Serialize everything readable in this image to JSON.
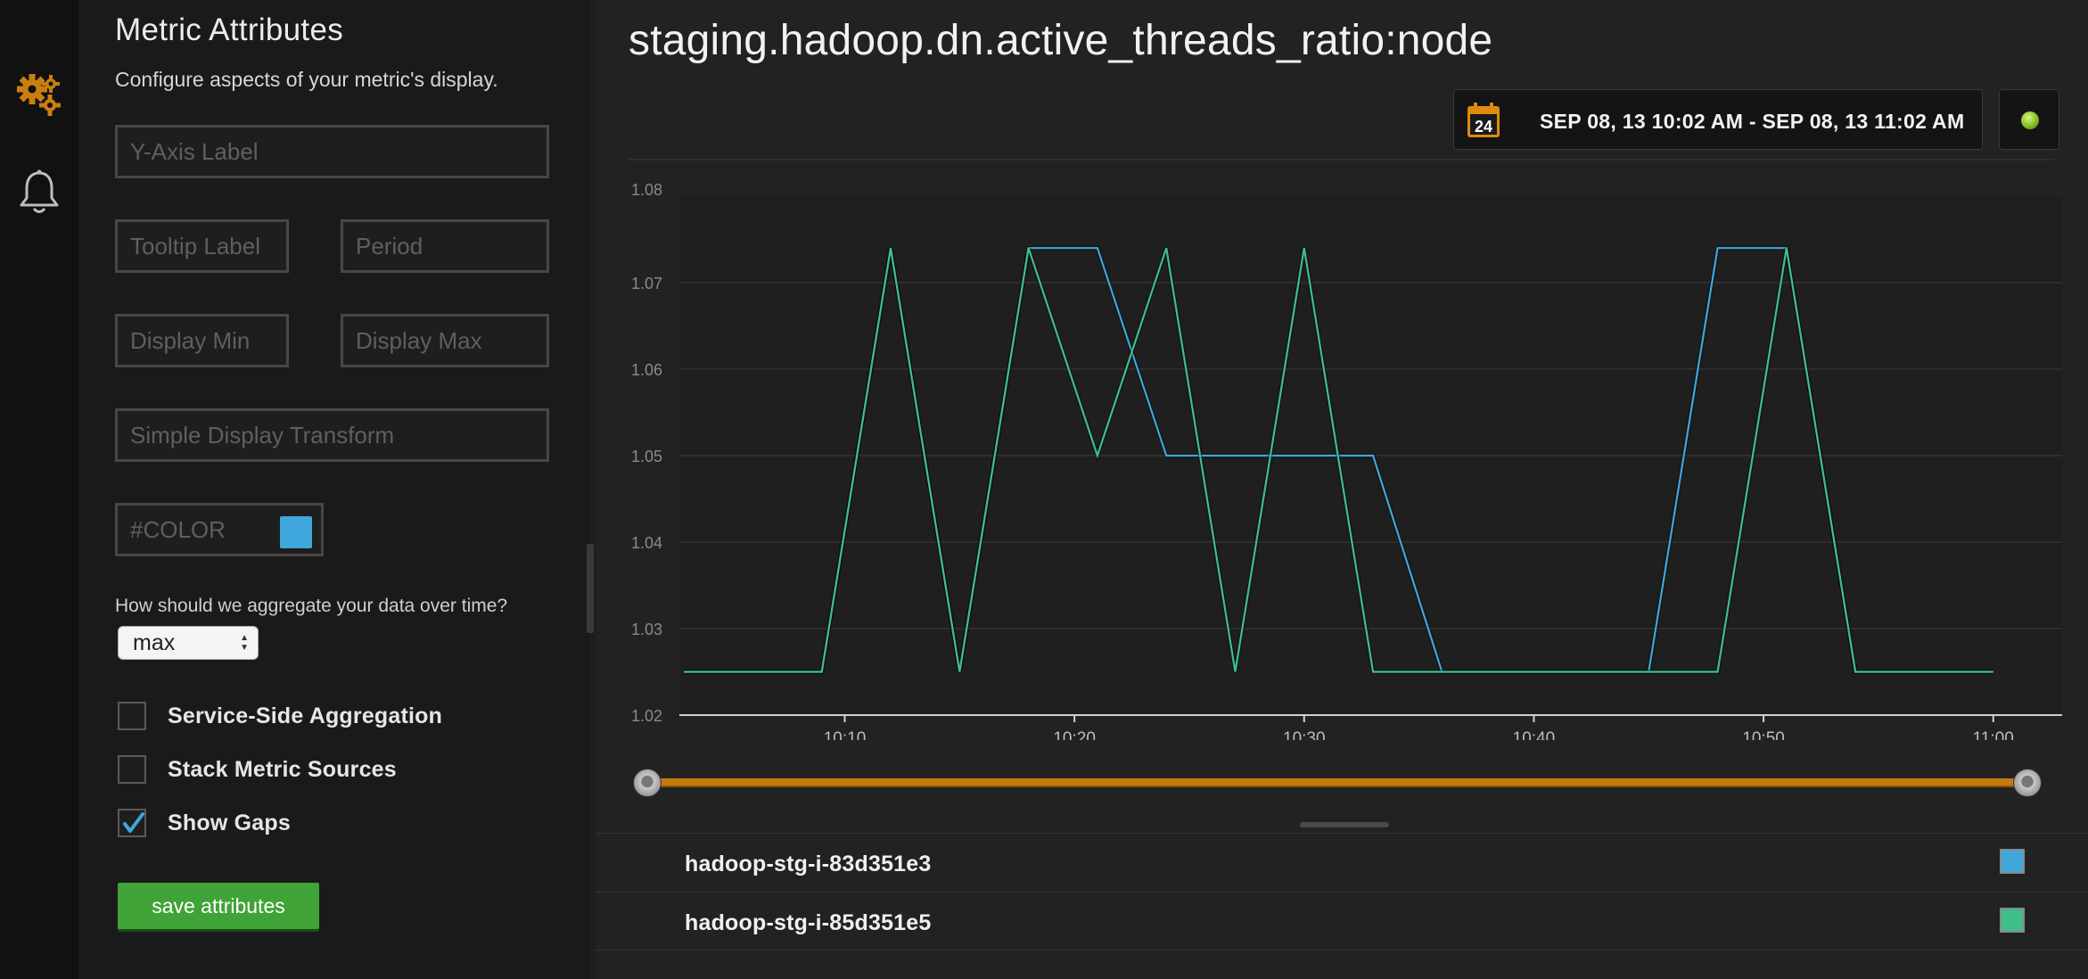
{
  "panel": {
    "title": "Metric Attributes",
    "subtitle": "Configure aspects of your metric's display.",
    "fields": {
      "y_axis_label": "Y-Axis Label",
      "tooltip_label": "Tooltip Label",
      "period": "Period",
      "display_min": "Display Min",
      "display_max": "Display Max",
      "transform": "Simple Display Transform",
      "color": "#COLOR"
    },
    "color_value": "#3fa7dc",
    "aggregation_question": "How should we aggregate your data over time?",
    "aggregation_value": "max",
    "checkboxes": [
      {
        "label": "Service-Side Aggregation",
        "checked": false
      },
      {
        "label": "Stack Metric Sources",
        "checked": false
      },
      {
        "label": "Show Gaps",
        "checked": true
      }
    ],
    "save_label": "save attributes"
  },
  "rail": {
    "icons": [
      "gears-icon",
      "bell-icon"
    ]
  },
  "main": {
    "metric_title": "staging.hadoop.dn.active_threads_ratio:node",
    "date_range": "SEP 08, 13 10:02 AM - SEP 08, 13 11:02 AM",
    "calendar_day": "24",
    "live_status": "live"
  },
  "chart_data": {
    "type": "line",
    "ylim": [
      1.02,
      1.08
    ],
    "y_ticks": [
      "1.08",
      "1.07",
      "1.06",
      "1.05",
      "1.04",
      "1.03",
      "1.02"
    ],
    "x_ticks": [
      "10:10",
      "10:20",
      "10:30",
      "10:40",
      "10:50",
      "11:00"
    ],
    "x_range_minutes": [
      2.8,
      63
    ],
    "grid": true,
    "series": [
      {
        "name": "hadoop-stg-i-83d351e3",
        "color": "#3fa7dc",
        "x": [
          "10:03",
          "10:09",
          "10:12",
          "10:15",
          "10:18",
          "10:21",
          "10:24",
          "10:27",
          "10:30",
          "10:33",
          "10:36",
          "10:39",
          "10:42",
          "10:45",
          "10:48",
          "10:51",
          "10:54",
          "10:57",
          "11:00"
        ],
        "values": [
          1.025,
          1.025,
          1.074,
          1.025,
          1.074,
          1.074,
          1.05,
          1.05,
          1.05,
          1.05,
          1.025,
          1.025,
          1.025,
          1.025,
          1.074,
          1.074,
          1.025,
          1.025,
          1.025
        ]
      },
      {
        "name": "hadoop-stg-i-85d351e5",
        "color": "#3fbf8b",
        "x": [
          "10:03",
          "10:09",
          "10:12",
          "10:15",
          "10:18",
          "10:21",
          "10:24",
          "10:27",
          "10:30",
          "10:33",
          "10:36",
          "10:39",
          "10:42",
          "10:45",
          "10:48",
          "10:51",
          "10:54",
          "10:57",
          "11:00"
        ],
        "values": [
          1.025,
          1.025,
          1.074,
          1.025,
          1.074,
          1.05,
          1.074,
          1.025,
          1.074,
          1.025,
          1.025,
          1.025,
          1.025,
          1.025,
          1.025,
          1.074,
          1.025,
          1.025,
          1.025
        ]
      }
    ]
  },
  "legend": [
    {
      "name": "hadoop-stg-i-83d351e3",
      "color": "#3fa7dc"
    },
    {
      "name": "hadoop-stg-i-85d351e5",
      "color": "#3fbf8b"
    }
  ]
}
